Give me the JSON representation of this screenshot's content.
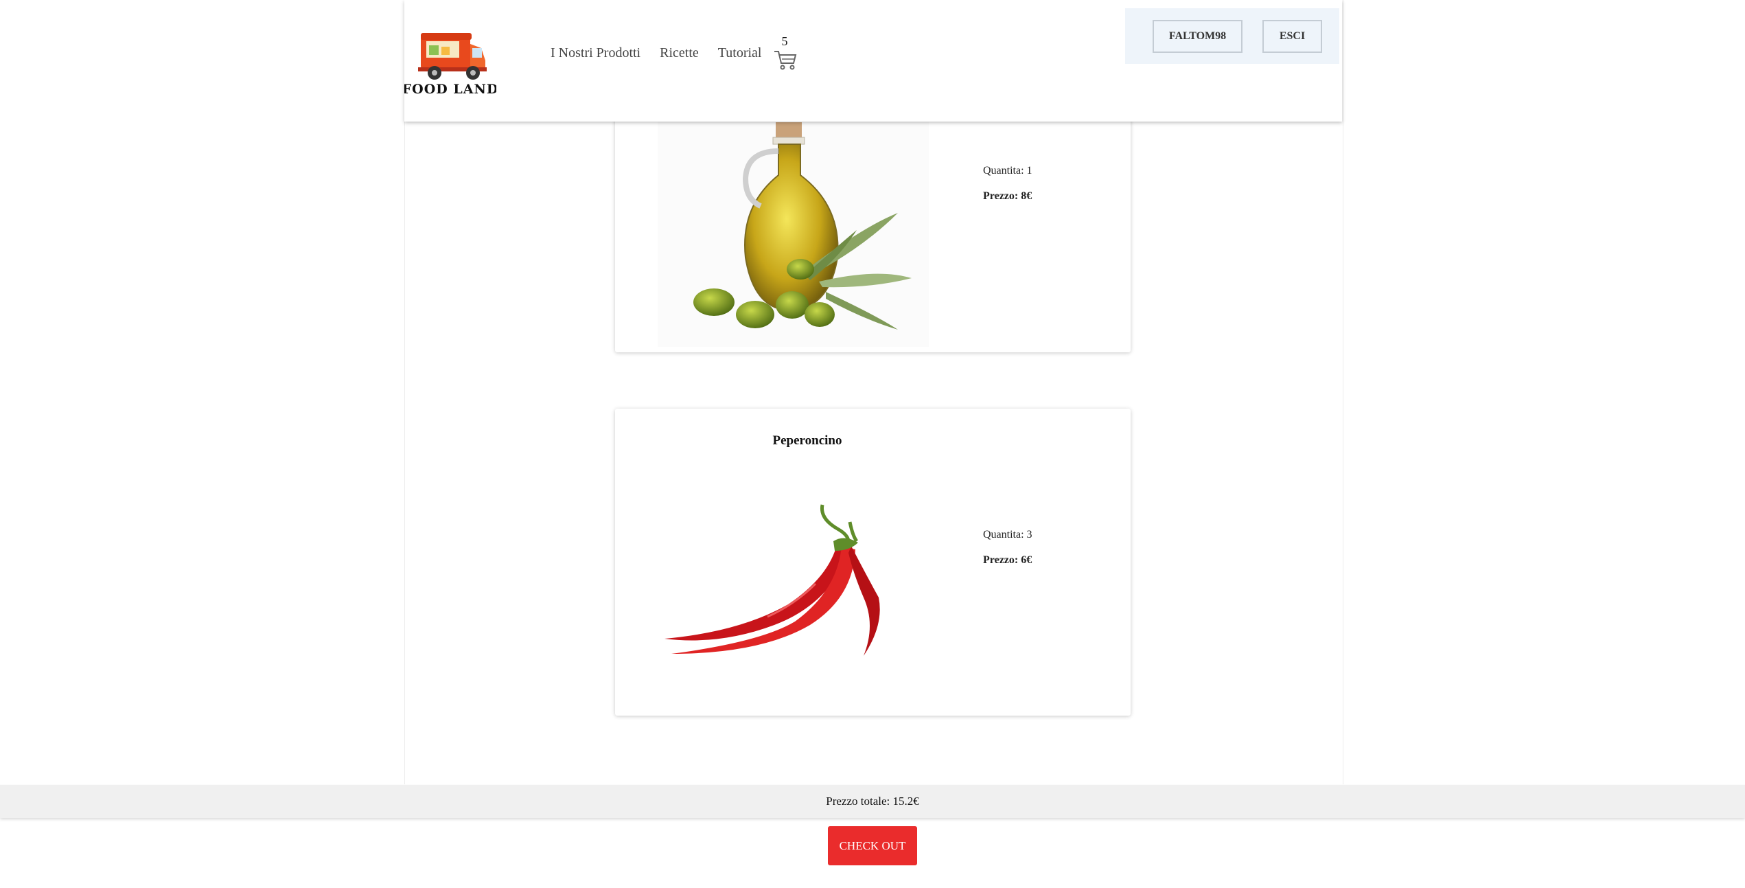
{
  "brand": {
    "logo_text": "FOOD LAND"
  },
  "nav": {
    "items": [
      {
        "label": "I Nostri Prodotti"
      },
      {
        "label": "Ricette"
      },
      {
        "label": "Tutorial"
      }
    ],
    "cart_count": "5"
  },
  "user": {
    "username_label": "FALTOM98",
    "logout_label": "ESCI"
  },
  "cart_items": [
    {
      "name": "",
      "quantity_text": "Quantita: 1",
      "price_text": "Prezzo: 8€",
      "image": "olive-oil-bottle-with-olives"
    },
    {
      "name": "Peperoncino",
      "quantity_text": "Quantita: 3",
      "price_text": "Prezzo: 6€",
      "image": "red-chili-peppers"
    }
  ],
  "summary": {
    "total_text": "Prezzo totale: 15.2€",
    "checkout_label": "CHECK OUT"
  },
  "colors": {
    "accent_red": "#ea2c2c",
    "panel_blue": "#eef4fa",
    "truck_orange": "#e8491d"
  }
}
